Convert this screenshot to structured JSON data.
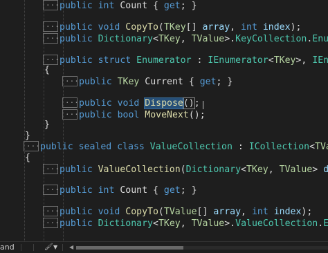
{
  "code": {
    "lines": [
      {
        "collapsed": true,
        "tokens": [
          {
            "t": "public ",
            "c": "kw"
          },
          {
            "t": "int ",
            "c": "kw"
          },
          {
            "t": "Count ",
            "c": "pr"
          },
          {
            "t": "{ ",
            "c": "pn"
          },
          {
            "t": "get",
            "c": "kw"
          },
          {
            "t": "; }",
            "c": "pn"
          }
        ]
      },
      {
        "collapsed": true,
        "tokens": [
          {
            "t": "public ",
            "c": "kw"
          },
          {
            "t": "void ",
            "c": "kw"
          },
          {
            "t": "CopyTo",
            "c": "mt"
          },
          {
            "t": "(",
            "c": "pn"
          },
          {
            "t": "TKey",
            "c": "tp"
          },
          {
            "t": "[] ",
            "c": "pn"
          },
          {
            "t": "array",
            "c": "vr"
          },
          {
            "t": ", ",
            "c": "pn"
          },
          {
            "t": "int ",
            "c": "kw"
          },
          {
            "t": "index",
            "c": "vr"
          },
          {
            "t": ");",
            "c": "pn"
          }
        ]
      },
      {
        "collapsed": true,
        "tokens": [
          {
            "t": "public ",
            "c": "kw"
          },
          {
            "t": "Dictionary",
            "c": "ty"
          },
          {
            "t": "<",
            "c": "pn"
          },
          {
            "t": "TKey",
            "c": "tp"
          },
          {
            "t": ", ",
            "c": "pn"
          },
          {
            "t": "TValue",
            "c": "tp"
          },
          {
            "t": ">.",
            "c": "pn"
          },
          {
            "t": "KeyCollection",
            "c": "ty"
          },
          {
            "t": ".",
            "c": "pn"
          },
          {
            "t": "Enumerator",
            "c": "ty"
          }
        ]
      },
      {
        "collapsed": true,
        "tokens": [
          {
            "t": "public ",
            "c": "kw"
          },
          {
            "t": "struct ",
            "c": "kw"
          },
          {
            "t": "Enumerator ",
            "c": "ty"
          },
          {
            "t": ": ",
            "c": "pn"
          },
          {
            "t": "IEnumerator",
            "c": "ty"
          },
          {
            "t": "<",
            "c": "pn"
          },
          {
            "t": "TKey",
            "c": "tp"
          },
          {
            "t": ">, ",
            "c": "pn"
          },
          {
            "t": "IEnumerator",
            "c": "ty"
          }
        ]
      },
      {
        "collapsed": false,
        "tokens": [
          {
            "t": "{",
            "c": "pn"
          }
        ]
      },
      {
        "collapsed": true,
        "tokens": [
          {
            "t": "public ",
            "c": "kw"
          },
          {
            "t": "TKey ",
            "c": "tp"
          },
          {
            "t": "Current ",
            "c": "pr"
          },
          {
            "t": "{ ",
            "c": "pn"
          },
          {
            "t": "get",
            "c": "kw"
          },
          {
            "t": "; }",
            "c": "pn"
          }
        ]
      },
      {
        "collapsed": true,
        "tokens": [
          {
            "t": "public ",
            "c": "kw"
          },
          {
            "t": "void ",
            "c": "kw"
          },
          {
            "t": "Dispose",
            "c": "mt",
            "hl": true
          },
          {
            "t": "()",
            "c": "pn",
            "bm": true
          },
          {
            "t": ";",
            "c": "pn"
          }
        ]
      },
      {
        "collapsed": true,
        "tokens": [
          {
            "t": "public ",
            "c": "kw"
          },
          {
            "t": "bool ",
            "c": "kw"
          },
          {
            "t": "MoveNext",
            "c": "mt"
          },
          {
            "t": "();",
            "c": "pn"
          }
        ]
      },
      {
        "collapsed": false,
        "tokens": [
          {
            "t": "}",
            "c": "pn"
          }
        ]
      },
      {
        "collapsed": false,
        "tokens": [
          {
            "t": "}",
            "c": "pn"
          }
        ]
      },
      {
        "collapsed": true,
        "tokens": [
          {
            "t": "public ",
            "c": "kw"
          },
          {
            "t": "sealed ",
            "c": "kw"
          },
          {
            "t": "class ",
            "c": "kw"
          },
          {
            "t": "ValueCollection ",
            "c": "ty"
          },
          {
            "t": ": ",
            "c": "pn"
          },
          {
            "t": "ICollection",
            "c": "ty"
          },
          {
            "t": "<",
            "c": "pn"
          },
          {
            "t": "TValue",
            "c": "tp"
          },
          {
            "t": ">,",
            "c": "pn"
          }
        ]
      },
      {
        "collapsed": false,
        "tokens": [
          {
            "t": "{",
            "c": "pn"
          }
        ]
      },
      {
        "collapsed": true,
        "tokens": [
          {
            "t": "public ",
            "c": "kw"
          },
          {
            "t": "ValueCollection",
            "c": "mt"
          },
          {
            "t": "(",
            "c": "pn"
          },
          {
            "t": "Dictionary",
            "c": "ty"
          },
          {
            "t": "<",
            "c": "pn"
          },
          {
            "t": "TKey",
            "c": "tp"
          },
          {
            "t": ", ",
            "c": "pn"
          },
          {
            "t": "TValue",
            "c": "tp"
          },
          {
            "t": "> ",
            "c": "pn"
          },
          {
            "t": "diction",
            "c": "vr"
          }
        ]
      },
      {
        "collapsed": true,
        "tokens": [
          {
            "t": "public ",
            "c": "kw"
          },
          {
            "t": "int ",
            "c": "kw"
          },
          {
            "t": "Count ",
            "c": "pr"
          },
          {
            "t": "{ ",
            "c": "pn"
          },
          {
            "t": "get",
            "c": "kw"
          },
          {
            "t": "; }",
            "c": "pn"
          }
        ]
      },
      {
        "collapsed": true,
        "tokens": [
          {
            "t": "public ",
            "c": "kw"
          },
          {
            "t": "void ",
            "c": "kw"
          },
          {
            "t": "CopyTo",
            "c": "mt"
          },
          {
            "t": "(",
            "c": "pn"
          },
          {
            "t": "TValue",
            "c": "tp"
          },
          {
            "t": "[] ",
            "c": "pn"
          },
          {
            "t": "array",
            "c": "vr"
          },
          {
            "t": ", ",
            "c": "pn"
          },
          {
            "t": "int ",
            "c": "kw"
          },
          {
            "t": "index",
            "c": "vr"
          },
          {
            "t": ");",
            "c": "pn"
          }
        ]
      },
      {
        "collapsed": true,
        "tokens": [
          {
            "t": "public ",
            "c": "kw"
          },
          {
            "t": "Dictionary",
            "c": "ty"
          },
          {
            "t": "<",
            "c": "pn"
          },
          {
            "t": "TKey",
            "c": "tp"
          },
          {
            "t": ", ",
            "c": "pn"
          },
          {
            "t": "TValue",
            "c": "tp"
          },
          {
            "t": ">.",
            "c": "pn"
          },
          {
            "t": "ValueCollection",
            "c": "ty"
          },
          {
            "t": ".",
            "c": "pn"
          },
          {
            "t": "Enumera",
            "c": "ty"
          }
        ]
      }
    ]
  },
  "status_bar": {
    "left_text": "and",
    "code_cleanup_icon": "brush-icon",
    "dropdown_icon": "chevron-down-icon",
    "scroll_left_icon": "chevron-left-icon",
    "horizontal_scroll_position": 0.0
  }
}
